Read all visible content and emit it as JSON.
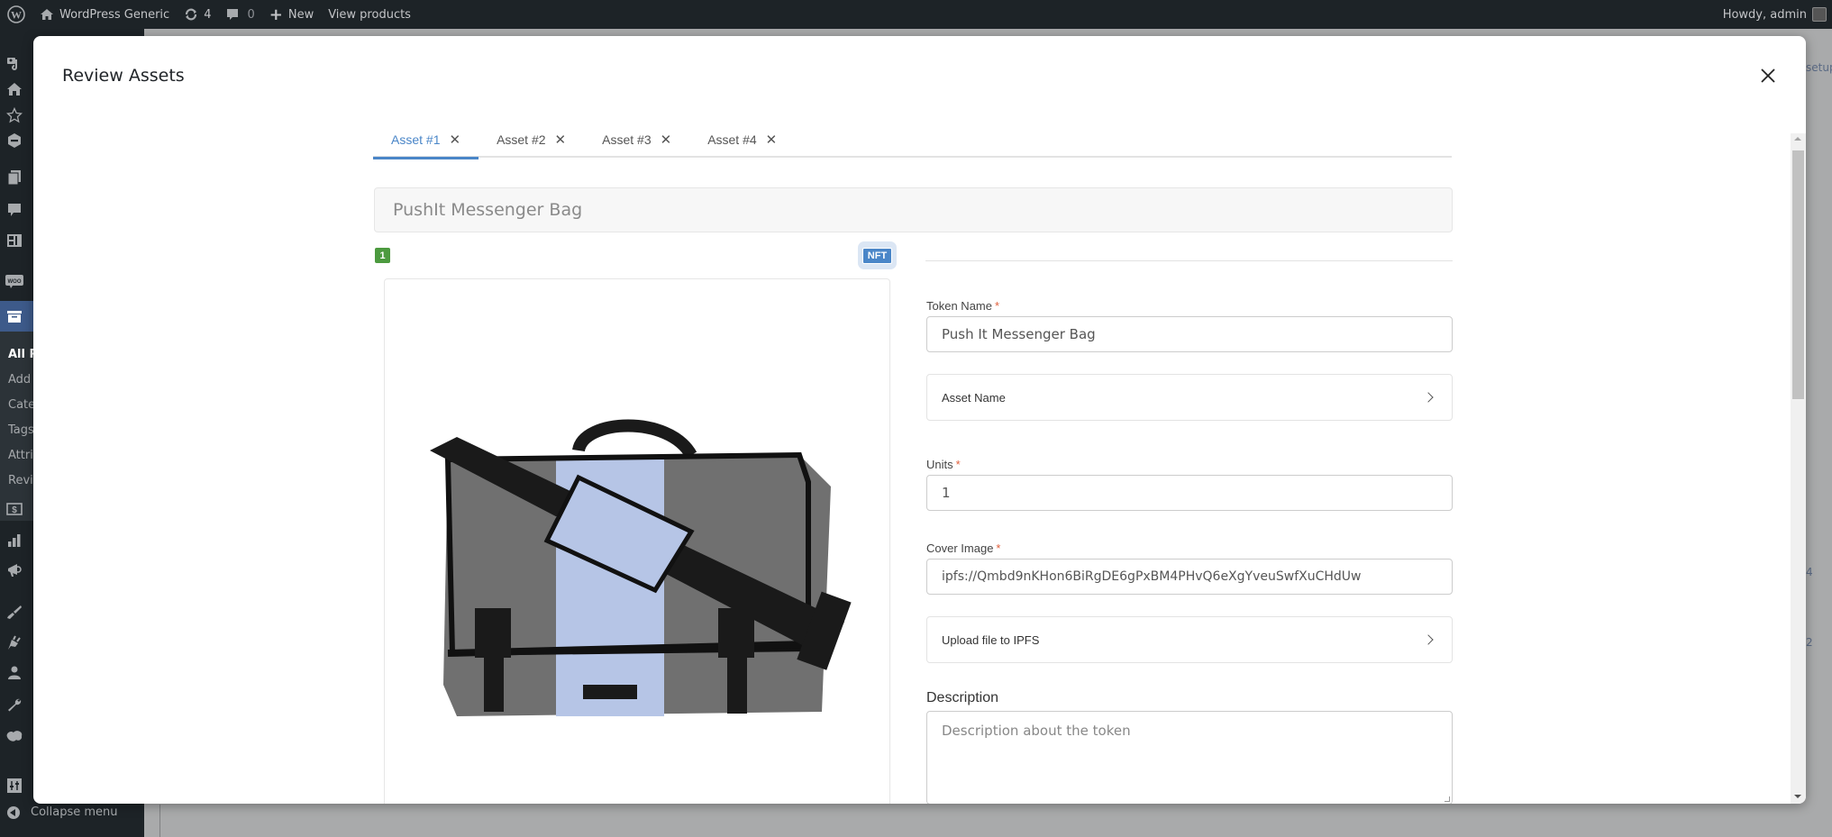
{
  "admin_bar": {
    "site_name": "WordPress Generic",
    "updates_count": "4",
    "comments_count": "0",
    "new_label": "New",
    "view_products_label": "View products",
    "greeting": "Howdy, admin"
  },
  "sidebar": {
    "submenu": [
      "All P",
      "Add",
      "Cate",
      "Tags",
      "Attri",
      "Revie"
    ],
    "collapse_label": "Collapse menu"
  },
  "background": {
    "setup_fragment": "setup",
    "row_values": [
      "4",
      "2"
    ]
  },
  "modal": {
    "title": "Review Assets",
    "tabs": [
      {
        "label": "Asset #1",
        "active": true
      },
      {
        "label": "Asset #2",
        "active": false
      },
      {
        "label": "Asset #3",
        "active": false
      },
      {
        "label": "Asset #4",
        "active": false
      }
    ],
    "product_title": "PushIt Messenger Bag",
    "index_badge": "1",
    "type_badge": "NFT",
    "image_alt": "Messenger bag product image",
    "form": {
      "token_name_label": "Token Name",
      "token_name_value": "Push It Messenger Bag",
      "asset_name_label": "Asset Name",
      "units_label": "Units",
      "units_value": "1",
      "cover_image_label": "Cover Image",
      "cover_image_value": "ipfs://Qmbd9nKHon6BiRgDE6gPxBM4PHvQ6eXgYveuSwfXuCHdUw",
      "upload_label": "Upload file to IPFS",
      "description_label": "Description",
      "description_placeholder": "Description about the token",
      "required_mark": "*"
    }
  },
  "colors": {
    "accent": "#4a86c8",
    "badge_green": "#4c9a3f",
    "required": "#e0603d",
    "admin_bar": "#1d2327"
  }
}
